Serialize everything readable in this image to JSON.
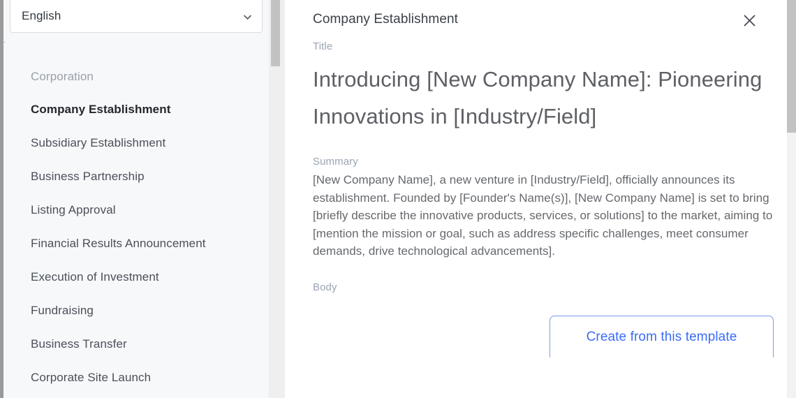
{
  "sidebar": {
    "language_select": {
      "value": "English",
      "chevron_icon": "chevron-down-icon"
    },
    "group_label": "Corporation",
    "items": [
      {
        "label": "Company Establishment",
        "selected": true
      },
      {
        "label": "Subsidiary Establishment",
        "selected": false
      },
      {
        "label": "Business Partnership",
        "selected": false
      },
      {
        "label": "Listing Approval",
        "selected": false
      },
      {
        "label": "Financial Results Announcement",
        "selected": false
      },
      {
        "label": "Execution of Investment",
        "selected": false
      },
      {
        "label": "Fundraising",
        "selected": false
      },
      {
        "label": "Business Transfer",
        "selected": false
      },
      {
        "label": "Corporate Site Launch",
        "selected": false
      }
    ]
  },
  "panel": {
    "header_title": "Company Establishment",
    "close_icon": "close-icon",
    "fields": {
      "title_label": "Title",
      "title_value": "Introducing [New Company Name]: Pioneering Innovations in [Industry/Field]",
      "summary_label": "Summary",
      "summary_value": "[New Company Name], a new venture in [Industry/Field], officially announces its establishment. Founded by [Founder's Name(s)], [New Company Name] is set to bring [briefly describe the innovative products, services, or solutions] to the market, aiming to [mention the mission or goal, such as address specific challenges, meet consumer demands, drive technological advancements].",
      "body_label": "Body"
    },
    "cta_label": "Create from this template"
  },
  "colors": {
    "accent_blue": "#3b6cf6",
    "accent_blue_border": "#7d9bf5",
    "sidebar_bg": "#f7f8fa",
    "muted_text": "#9aa4b2",
    "body_text": "#65686d",
    "scrollbar_thumb": "#c2c2c2"
  }
}
